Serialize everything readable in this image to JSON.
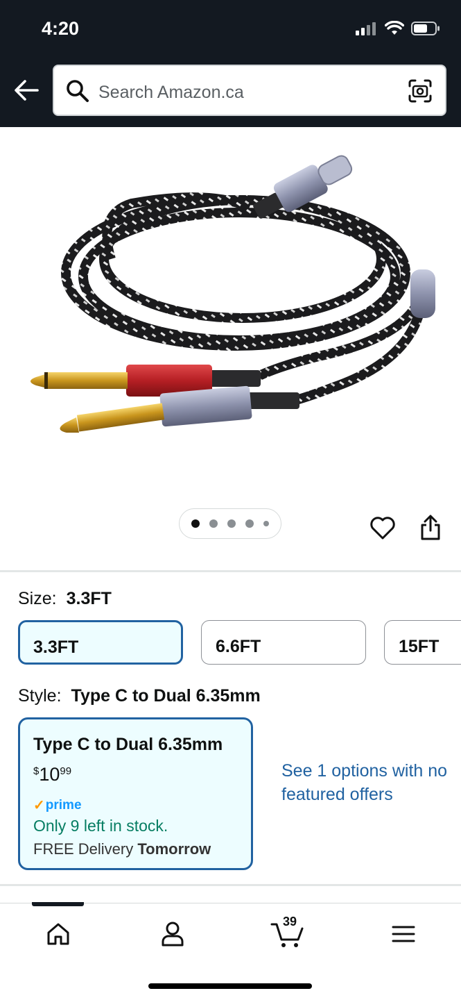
{
  "status_bar": {
    "time": "4:20"
  },
  "search": {
    "placeholder": "Search Amazon.ca"
  },
  "icons": {
    "back": "back-arrow-icon",
    "search": "search-icon",
    "camera": "camera-scan-icon",
    "wishlist": "heart-icon",
    "share": "share-icon",
    "home": "home-icon",
    "account": "person-icon",
    "cart": "cart-icon",
    "menu": "menu-icon"
  },
  "product": {
    "image_alt": "Braided USB Type C to dual 6.35mm cable",
    "carousel": {
      "total_images": 5,
      "active_index": 0
    }
  },
  "size": {
    "label": "Size:",
    "selected": "3.3FT",
    "options": [
      "3.3FT",
      "6.6FT",
      "15FT"
    ]
  },
  "style": {
    "label": "Style:",
    "selected": "Type C to Dual 6.35mm",
    "card": {
      "title": "Type C to Dual 6.35mm",
      "price_symbol": "$",
      "price_whole": "10",
      "price_fraction": "99",
      "prime_label": "prime",
      "stock": "Only 9 left in stock.",
      "delivery_prefix": "FREE Delivery",
      "delivery_day": "Tomorrow"
    },
    "see_options": "See 1 options with no featured offers"
  },
  "bottom_nav": {
    "cart_count": "39"
  },
  "colors": {
    "header_bg": "#131921",
    "link_blue": "#2162a1",
    "selected_bg": "#edfdff",
    "stock_green": "#067d62",
    "prime_blue": "#1399ff",
    "prime_check": "#ff9900"
  }
}
